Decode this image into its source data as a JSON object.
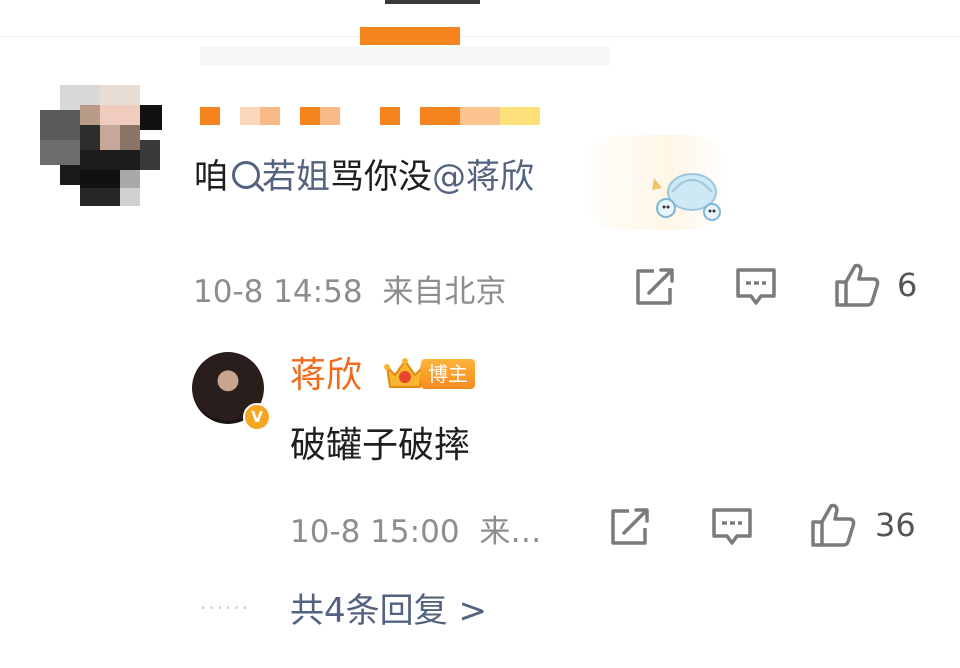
{
  "comment": {
    "parts": {
      "prefix": "咱",
      "keyword": "若姐",
      "middle": "骂你没",
      "mention": "@蒋欣"
    },
    "timestamp": "10-8 14:58",
    "location": "来自北京",
    "like_count": "6"
  },
  "reply": {
    "author": "蒋欣",
    "badge": "博主",
    "verified_mark": "V",
    "text": "破罐子破摔",
    "timestamp": "10-8 15:00",
    "location_truncated": "来…",
    "like_count": "36"
  },
  "more_replies": {
    "dots": "······",
    "label": "共4条回复 >"
  },
  "colors": {
    "accent_orange": "#f06c1d",
    "link_blue": "#52627f",
    "meta_gray": "#8d8d8d",
    "badge_gold": "#f5a623"
  },
  "icons": [
    "share-icon",
    "comment-icon",
    "like-icon",
    "search-icon",
    "crown-icon"
  ]
}
